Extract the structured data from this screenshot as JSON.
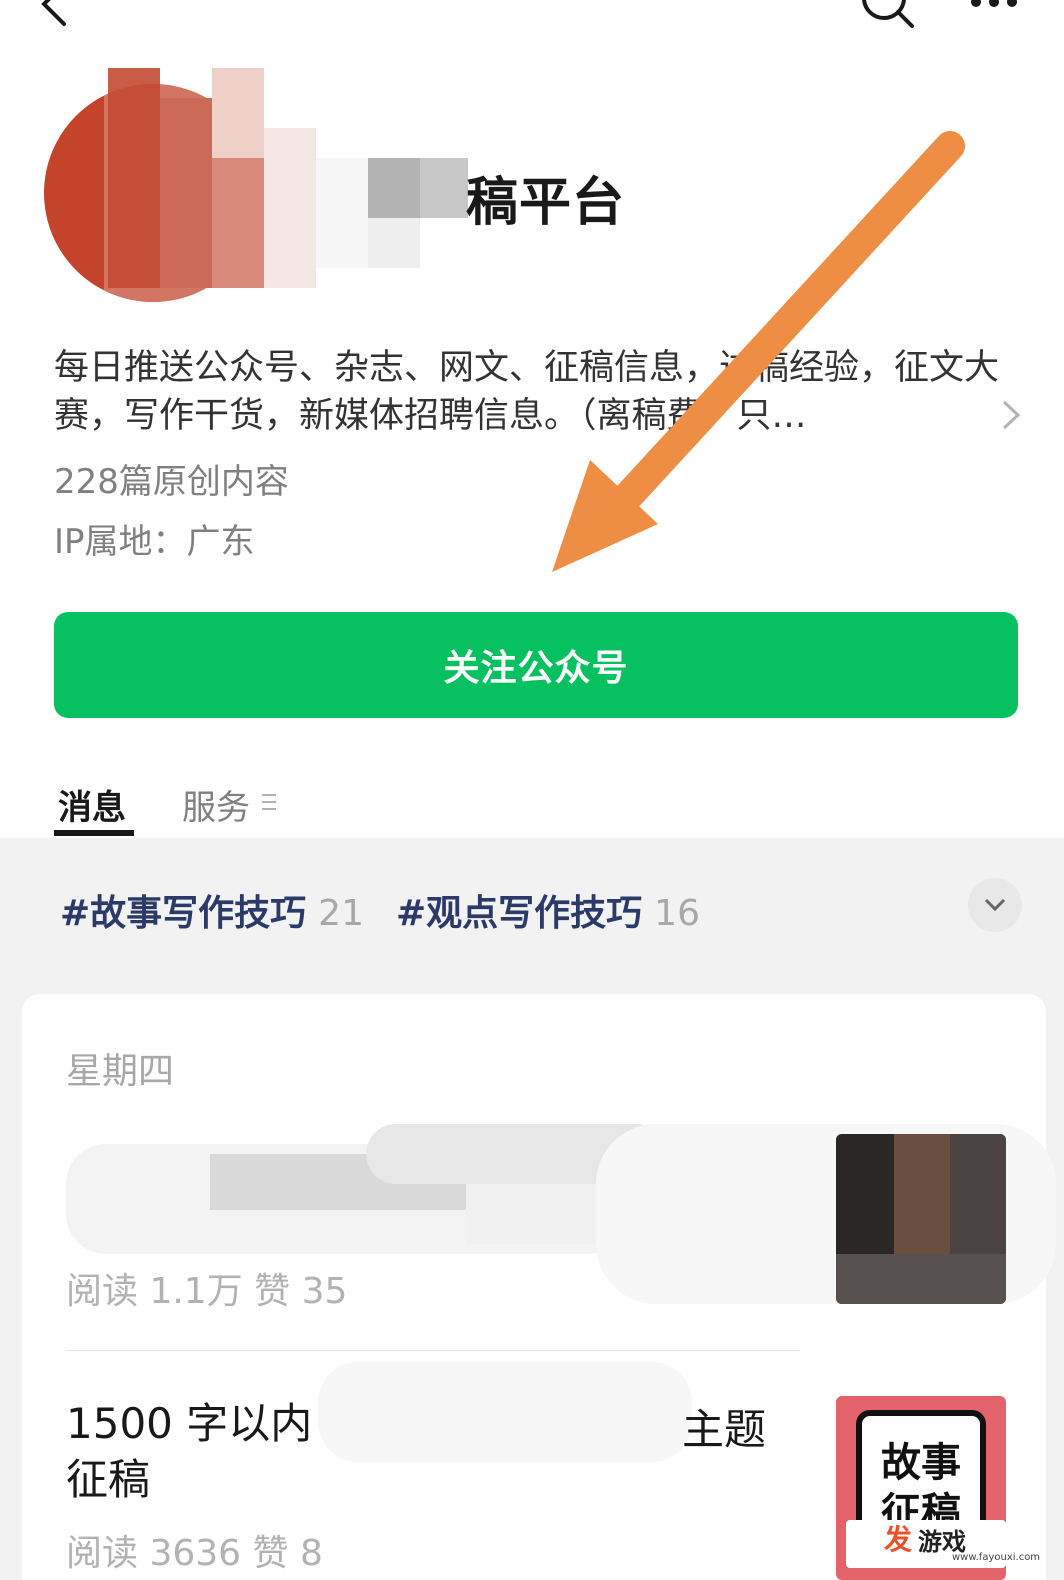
{
  "topbar": {
    "back_icon": "chevron-left-icon",
    "search_icon": "search-icon",
    "more_icon": "more-dots-icon"
  },
  "account": {
    "name_visible": "稿平台",
    "description": "每日推送公众号、杂志、网文、征稿信息，过稿经验，征文大赛，写作干货，新媒体招聘信息。（离稿费，只…",
    "original_count": "228篇原创内容",
    "ip": "IP属地：广东"
  },
  "follow_button": "关注公众号",
  "tabs": {
    "messages": "消息",
    "services": "服务"
  },
  "tags": [
    {
      "label": "#故事写作技巧",
      "count": "21"
    },
    {
      "label": "#观点写作技巧",
      "count": "16"
    }
  ],
  "feed": {
    "day": "星期四",
    "articles": [
      {
        "title": "",
        "meta": "阅读 1.1万  赞 35"
      },
      {
        "title_prefix": "1500 字以内",
        "title_suffix": "主题",
        "title_line2": "征稿",
        "meta": "阅读 3636  赞 8"
      }
    ]
  },
  "thumb2_text": {
    "line1": "故事",
    "line2": "征稿"
  },
  "watermark": {
    "fa": "发",
    "text": "游戏",
    "url": "www.fayouxi.com"
  },
  "colors": {
    "accent_green": "#07c160",
    "tag_blue": "#2b3a68",
    "arrow_orange": "#ee8e44",
    "avatar_red": "#c4432b"
  }
}
